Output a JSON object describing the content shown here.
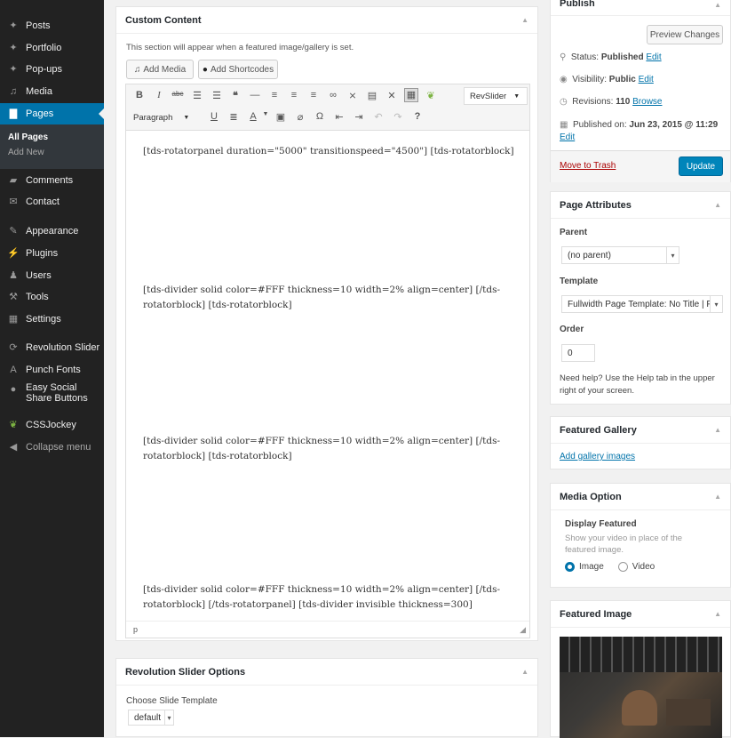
{
  "sidebar": {
    "items": [
      {
        "label": "Posts",
        "icon": "pushpin-icon"
      },
      {
        "label": "Portfolio",
        "icon": "pushpin-icon"
      },
      {
        "label": "Pop-ups",
        "icon": "pushpin-icon"
      },
      {
        "label": "Media",
        "icon": "media-icon"
      },
      {
        "label": "Pages",
        "icon": "pages-icon"
      },
      {
        "label": "Comments",
        "icon": "comments-icon"
      },
      {
        "label": "Contact",
        "icon": "mail-icon"
      },
      {
        "label": "Appearance",
        "icon": "brush-icon"
      },
      {
        "label": "Plugins",
        "icon": "plug-icon"
      },
      {
        "label": "Users",
        "icon": "users-icon"
      },
      {
        "label": "Tools",
        "icon": "wrench-icon"
      },
      {
        "label": "Settings",
        "icon": "settings-icon"
      },
      {
        "label": "Revolution Slider",
        "icon": "refresh-icon"
      },
      {
        "label": "Punch Fonts",
        "icon": "font-icon"
      },
      {
        "label": "Easy Social Share Buttons",
        "icon": "share-icon"
      },
      {
        "label": "CSSJockey",
        "icon": "leaf-icon"
      },
      {
        "label": "Collapse menu",
        "icon": "collapse-icon"
      }
    ],
    "submenu": [
      "All Pages",
      "Add New"
    ]
  },
  "custom_content": {
    "title": "Custom Content",
    "description": "This section will appear when a featured image/gallery is set.",
    "add_media": "Add Media",
    "add_shortcodes": "Add Shortcodes",
    "revslider": "RevSlider",
    "format_select": "Paragraph",
    "paragraphs": [
      "[tds-rotatorpanel duration=\"5000\" transitionspeed=\"4500\"] [tds-rotatorblock]",
      "[tds-divider solid color=#FFF thickness=10 width=2% align=center] [/tds-rotatorblock] [tds-rotatorblock]",
      "[tds-divider solid color=#FFF thickness=10 width=2% align=center] [/tds-rotatorblock] [tds-rotatorblock]",
      "[tds-divider solid color=#FFF thickness=10 width=2% align=center] [/tds-rotatorblock] [/tds-rotatorpanel] [tds-divider invisible thickness=300]"
    ],
    "status_path": "p"
  },
  "rev_slider": {
    "title": "Revolution Slider Options",
    "choose_label": "Choose Slide Template",
    "template_value": "default"
  },
  "publish": {
    "title": "Publish",
    "preview": "Preview Changes",
    "status_label": "Status:",
    "status_value": "Published",
    "visibility_label": "Visibility:",
    "visibility_value": "Public",
    "revisions_label": "Revisions:",
    "revisions_value": "110",
    "browse": "Browse",
    "published_on_label": "Published on:",
    "published_on_value": "Jun 23, 2015 @ 11:29",
    "edit": "Edit",
    "trash": "Move to Trash",
    "update": "Update"
  },
  "page_attributes": {
    "title": "Page Attributes",
    "parent_label": "Parent",
    "parent_value": "(no parent)",
    "template_label": "Template",
    "template_value": "Fullwidth Page Template: No Title | F",
    "order_label": "Order",
    "order_value": "0",
    "help": "Need help? Use the Help tab in the upper right of your screen."
  },
  "featured_gallery": {
    "title": "Featured Gallery",
    "add": "Add gallery images"
  },
  "media_option": {
    "title": "Media Option",
    "display_label": "Display Featured",
    "description": "Show your video in place of the featured image.",
    "option_image": "Image",
    "option_video": "Video"
  },
  "featured_image": {
    "title": "Featured Image"
  },
  "colors": {
    "accent": "#0073aa",
    "sidebar": "#222222",
    "trash": "#a00000"
  }
}
